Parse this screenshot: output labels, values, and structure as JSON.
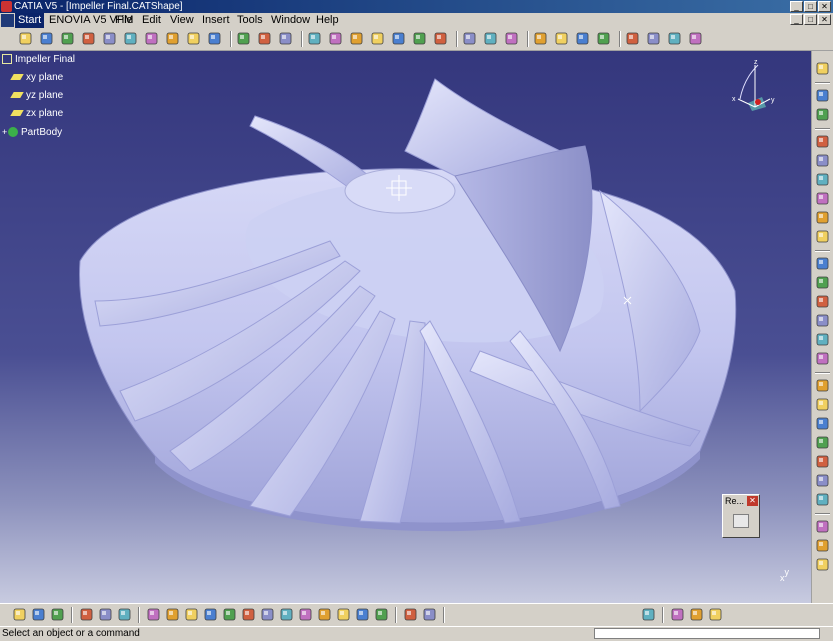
{
  "window": {
    "title": "CATIA V5 - [Impeller Final.CATShape]",
    "buttons": [
      "_",
      "□",
      "✕"
    ]
  },
  "menu": {
    "items": [
      "Start",
      "ENOVIA V5 VPM",
      "File",
      "Edit",
      "View",
      "Insert",
      "Tools",
      "Window",
      "Help"
    ],
    "doc_buttons": [
      "_",
      "□",
      "✕"
    ]
  },
  "tree": {
    "root": "Impeller Final",
    "items": [
      "xy plane",
      "yz plane",
      "zx plane",
      "PartBody"
    ]
  },
  "compass": {
    "x_label": "x",
    "y_label": "y",
    "z_label": "z"
  },
  "axis_hint": {
    "x": "x",
    "y": "y"
  },
  "dialog": {
    "title": "Re...",
    "close": "✕"
  },
  "status": {
    "message": "Select an object or a command",
    "command_value": ""
  },
  "colors": {
    "viewport_top": "#34377d",
    "viewport_bottom": "#c8cbe0",
    "part_color": "#c8cbf2",
    "title_bar": "#0a246a"
  },
  "icons": {
    "top_toolbar": [
      "new-icon",
      "open-icon",
      "save-icon",
      "print-icon",
      "cut-icon",
      "copy-icon",
      "paste-icon",
      "undo-icon",
      "redo-icon",
      "whats-this-icon",
      "point-icon",
      "spline-icon",
      "helix-icon",
      "sketch-surface-icon",
      "extrude-icon",
      "offset-icon",
      "join-icon",
      "split-icon",
      "macro-icon",
      "analysis-icon",
      "plane-icon",
      "measure-icon",
      "text-icon",
      "render-icon",
      "sweep-icon",
      "blend-icon",
      "render-style-icon",
      "grid-icon",
      "point2-icon",
      "line-icon",
      "plane2-icon"
    ],
    "bottom_toolbar": [
      "formula-icon",
      "knowledge-icon",
      "table-icon",
      "tree-icon",
      "lock-icon",
      "catalog-icon",
      "fly-icon",
      "fit-all-icon",
      "pan-icon",
      "rotate-icon",
      "zoom-in-icon",
      "zoom-out-icon",
      "normal-view-icon",
      "views-icon",
      "render-style-icon",
      "hide-show-icon",
      "swap-icon",
      "select-icon",
      "apply-material-icon",
      "update-icon",
      "publish-icon",
      "sketcher-icon",
      "3d-compass-icon",
      "shading-icon",
      "catia-logo-icon"
    ],
    "right_toolbar": [
      "select-arrow-icon",
      "sketch-icon",
      "curve-icon",
      "extrude-icon",
      "revolve-icon",
      "sweep-icon",
      "fill-icon",
      "blend-icon",
      "offset-icon",
      "trim-icon",
      "join-icon",
      "heal-icon",
      "boundary-icon",
      "extract-icon",
      "fillet-icon",
      "draft-icon",
      "chamfer-icon",
      "thickness-icon",
      "translate-icon",
      "rotate-icon",
      "symmetry-icon",
      "scale-icon",
      "analysis-icon",
      "render-icon",
      "snapshot-icon"
    ]
  }
}
